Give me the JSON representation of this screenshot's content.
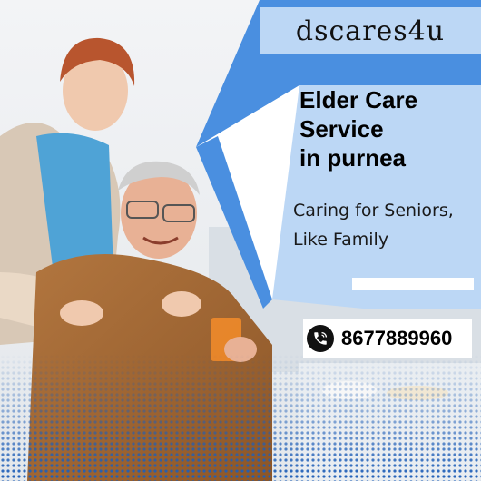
{
  "brand": {
    "name": "dscares4u"
  },
  "headline": {
    "line1": "Elder Care",
    "line2": "Service",
    "line3": "in purnea"
  },
  "tagline": {
    "line1": "Caring for Seniors,",
    "line2": "Like Family"
  },
  "contact": {
    "phone": "8677889960",
    "icon": "phone-icon"
  },
  "colors": {
    "accent_blue": "#4a8fe0",
    "light_blue": "#bcd7f5",
    "white": "#ffffff",
    "text": "#000000"
  }
}
